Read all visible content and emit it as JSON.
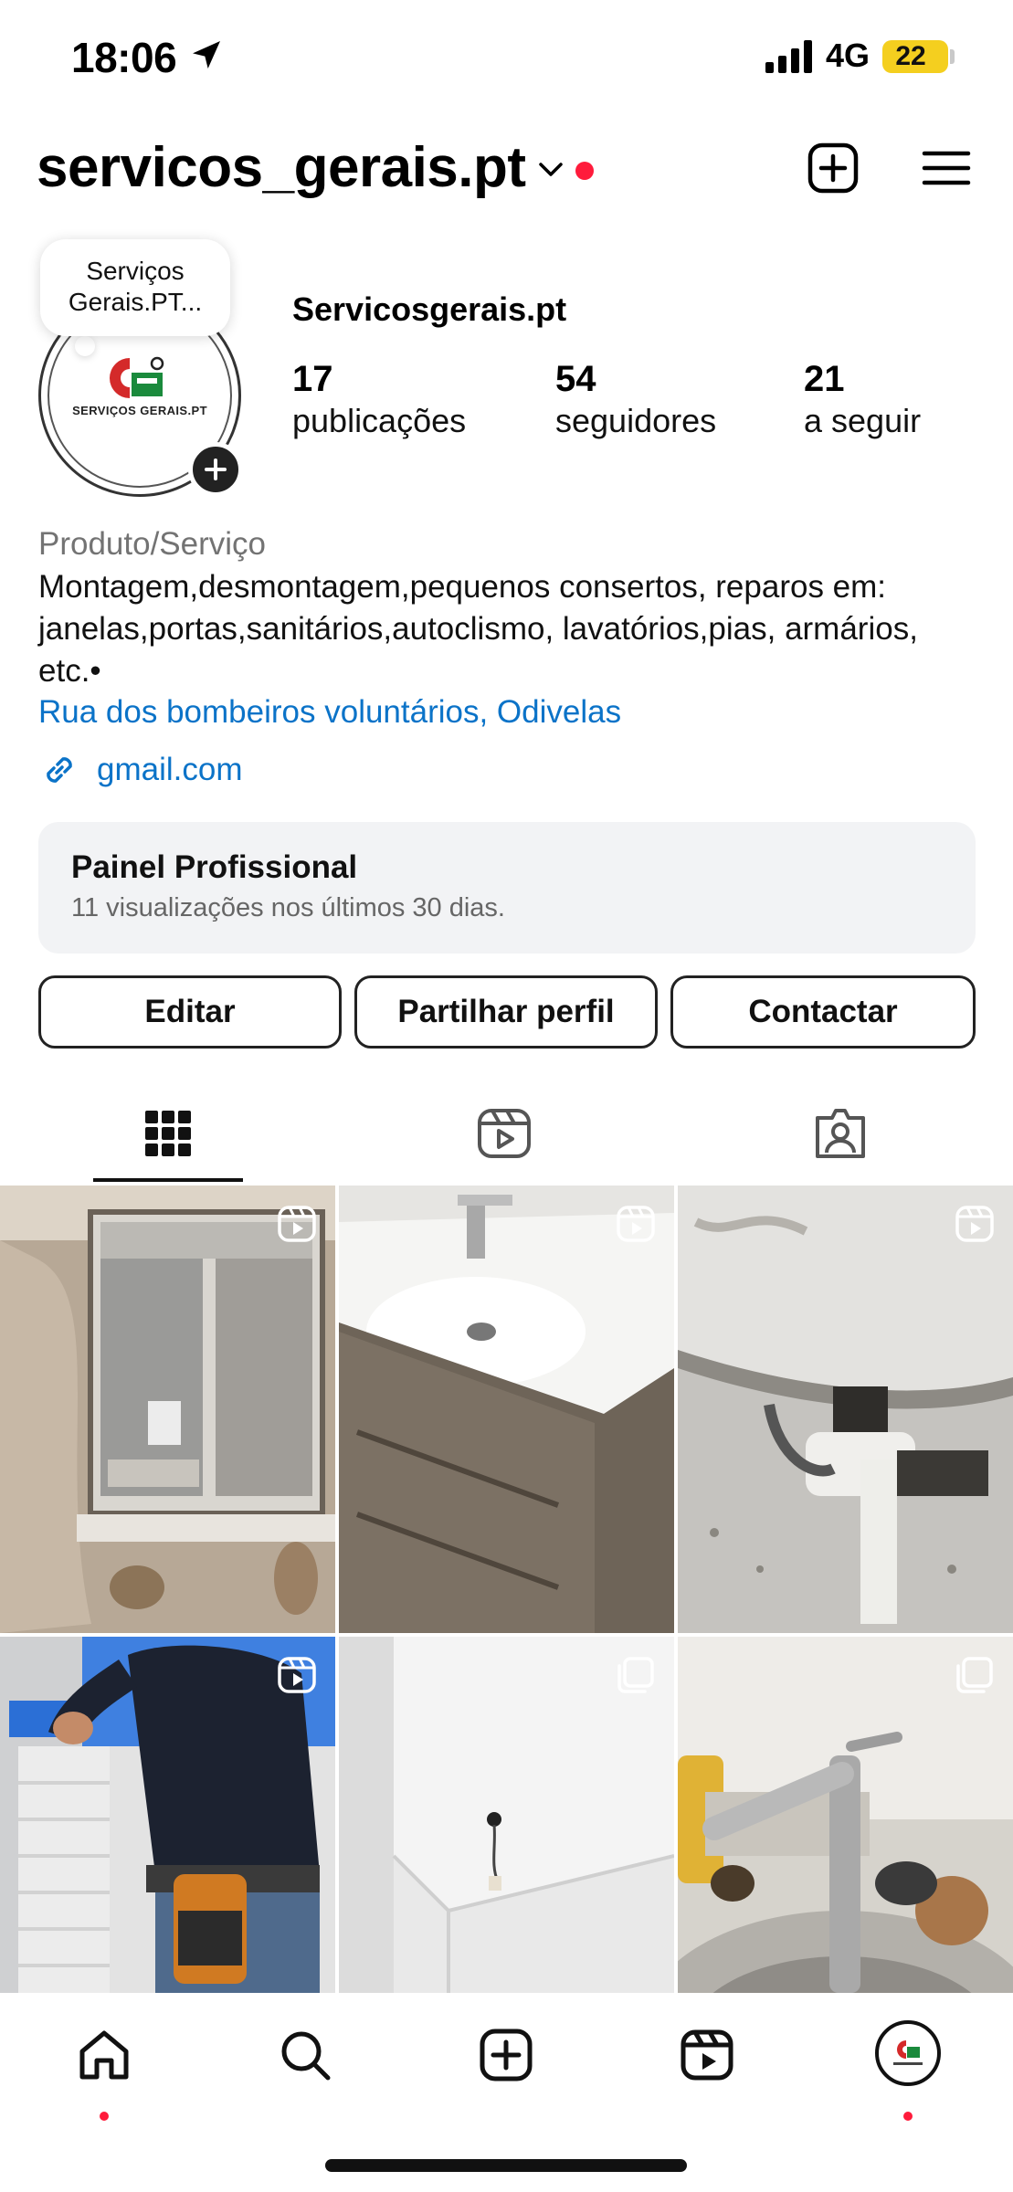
{
  "status_bar": {
    "time": "18:06",
    "network": "4G",
    "battery": "22"
  },
  "header": {
    "username": "servicos_gerais.pt",
    "has_new_activity": true
  },
  "profile": {
    "note": "Serviços Gerais.PT...",
    "logo_text": "SERVIÇOS GERAIS.PT",
    "display_name": "Servicosgerais.pt",
    "stats": [
      {
        "value": "17",
        "label": "publicações"
      },
      {
        "value": "54",
        "label": "seguidores"
      },
      {
        "value": "21",
        "label": "a seguir"
      }
    ],
    "category": "Produto/Serviço",
    "bio": "Montagem,desmontagem,pequenos consertos, reparos em: janelas,portas,sanitários,autoclismo, lavatórios,pias, armários, etc.•",
    "address": "Rua dos bombeiros voluntários, Odivelas",
    "link": "gmail.com"
  },
  "dashboard": {
    "title": "Painel Profissional",
    "subtitle": "11 visualizações nos últimos 30 dias."
  },
  "actions": {
    "edit": "Editar",
    "share": "Partilhar perfil",
    "contact": "Contactar"
  },
  "tabs": [
    {
      "icon": "grid-icon",
      "active": true
    },
    {
      "icon": "reels-icon",
      "active": false
    },
    {
      "icon": "tagged-icon",
      "active": false
    }
  ],
  "posts": [
    {
      "subject": "window",
      "badge": "reel-icon"
    },
    {
      "subject": "bathroom-sink",
      "badge": "reel-icon"
    },
    {
      "subject": "sink-drain-pipe",
      "badge": "reel-icon"
    },
    {
      "subject": "worker-installing",
      "badge": "reel-icon"
    },
    {
      "subject": "ceiling-wires",
      "badge": "multi-photo-icon"
    },
    {
      "subject": "kitchen-faucet",
      "badge": "multi-photo-icon"
    }
  ],
  "bottom_nav": [
    {
      "icon": "home-icon",
      "active": true
    },
    {
      "icon": "search-icon"
    },
    {
      "icon": "create-icon"
    },
    {
      "icon": "reels-icon"
    },
    {
      "icon": "profile-avatar"
    }
  ],
  "colors": {
    "accent_blue": "#0b73c8",
    "notification_red": "#ff1b3b",
    "battery_yellow": "#f4cf1f",
    "card_gray": "#f2f3f5"
  }
}
